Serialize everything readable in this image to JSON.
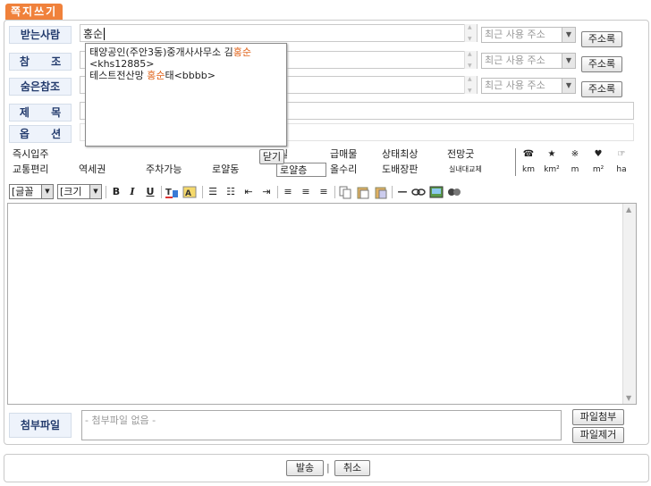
{
  "title": "쪽지쓰기",
  "fields": {
    "recipient_label": "받는사람",
    "recipient_value": "홍순",
    "cc_label": "참 조",
    "bcc_label": "숨은참조",
    "subject_label": "제 목",
    "options_label": "옵 션"
  },
  "recent_address": {
    "placeholder": "최근 사용 주소"
  },
  "address_book_label": "주소록",
  "autocomplete": {
    "items": [
      {
        "before": "태양공인(주안3동)중개사사무소 김",
        "match": "홍순",
        "after": "",
        "email": "<khs12885>"
      },
      {
        "before": "테스트전산망 ",
        "match": "홍순",
        "after": "태<bbbb>"
      }
    ],
    "close_label": "닫기"
  },
  "options_row1": [
    "즉시입주",
    "",
    "",
    "",
    "",
    "실",
    "급매물",
    "상태최상",
    "전망굿"
  ],
  "options_row2": [
    "교통편리",
    "역세권",
    "주차가능",
    "로얄동",
    "로얄층",
    "올수리",
    "도배장판",
    "실내대교체"
  ],
  "symbols_row1": [
    "☎",
    "★",
    "※",
    "♥",
    "☞"
  ],
  "symbols_row2": [
    "km",
    "km²",
    "m",
    "m²",
    "ha"
  ],
  "toolbar": {
    "font_label": "글꼴",
    "size_label": "크기",
    "bold": "B",
    "italic": "I",
    "underline": "U"
  },
  "attachment": {
    "label": "첨부파일",
    "placeholder": "- 첨부파일 없음 -",
    "attach_button": "파일첨부",
    "remove_button": "파일제거"
  },
  "actions": {
    "send": "발송",
    "separator": "|",
    "cancel": "취소"
  }
}
